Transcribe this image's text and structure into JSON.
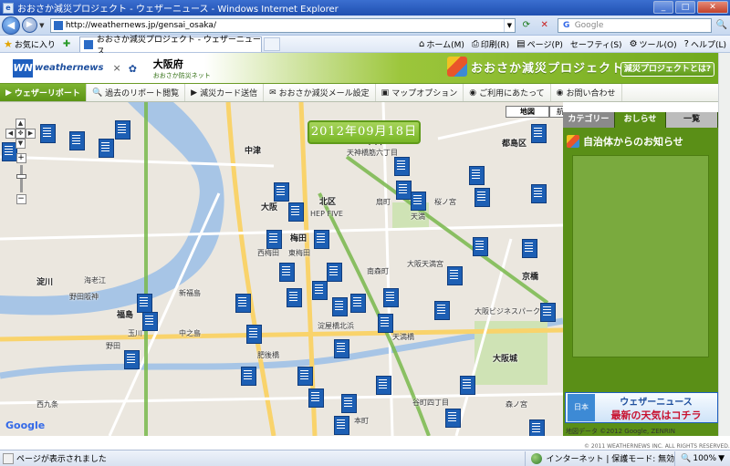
{
  "browser": {
    "title": "おおさか減災プロジェクト - ウェザーニュース - Windows Internet Explorer",
    "url": "http://weathernews.jp/gensai_osaka/",
    "search_placeholder": "Google",
    "favorites_label": "お気に入り",
    "tab_title": "おおさか減災プロジェクト - ウェザーニュース",
    "commands": [
      "ホーム(M)",
      "印刷(R)",
      "ページ(P)",
      "セーフティ(S)",
      "ツール(O)",
      "ヘルプ(L)"
    ],
    "status_text": "ページが表示されました",
    "zone_text": "インターネット | 保護モード: 無効",
    "zoom": "100%"
  },
  "site": {
    "brand": "weathernews",
    "brand_mark": "WN",
    "partner": "大阪府",
    "partner_sub": "おおさか防災ネット",
    "project_title": "おおさか減災プロジェクト",
    "project_about": "減災プロジェクトとは?"
  },
  "nav": [
    {
      "label": "ウェザーリポート",
      "icon": "▶"
    },
    {
      "label": "過去のリポート閲覧",
      "icon": "🔍"
    },
    {
      "label": "減災カード送信",
      "icon": "▶"
    },
    {
      "label": "おおさか減災メール設定",
      "icon": "✉"
    },
    {
      "label": "マップオプション",
      "icon": "▣"
    },
    {
      "label": "ご利用にあたって",
      "icon": "◉"
    },
    {
      "label": "お問い合わせ",
      "icon": "◉"
    }
  ],
  "map": {
    "date": "2012年09月18日",
    "type_buttons": [
      "地図",
      "航空写真"
    ],
    "google": "Google",
    "copyright": "地図データ ©2012 Google, ZENRIN",
    "labels": [
      "中津",
      "梅田",
      "北区",
      "天満",
      "扇町",
      "南森町",
      "大阪天満宮",
      "中之島",
      "淀屋橋",
      "北浜",
      "天満橋",
      "大阪城",
      "京橋",
      "大阪ビジネスパーク",
      "福島",
      "野田",
      "西九条",
      "都島区",
      "桜ノ宮",
      "谷町四丁目",
      "肥後橋",
      "本町",
      "淀川",
      "海老江",
      "HEP FIVE",
      "大阪",
      "西梅田",
      "東梅田",
      "新福島",
      "玉川",
      "六甲",
      "天神橋筋六丁目",
      "森ノ宮",
      "野田阪神"
    ]
  },
  "panel": {
    "tabs": [
      "カテゴリー",
      "おしらせ",
      "一覧"
    ],
    "heading": "自治体からのお知らせ",
    "banner_line1": "ウェザーニュース",
    "banner_line2": "最新の天気はコチラ",
    "banner_map": "日本",
    "copyright": "© 2011 WEATHERNEWS INC. ALL RIGHTS RESERVED."
  },
  "colors": {
    "accent_green": "#5a8f17",
    "brand_blue": "#1e5fbf",
    "title_blue": "#1f4fb0"
  }
}
